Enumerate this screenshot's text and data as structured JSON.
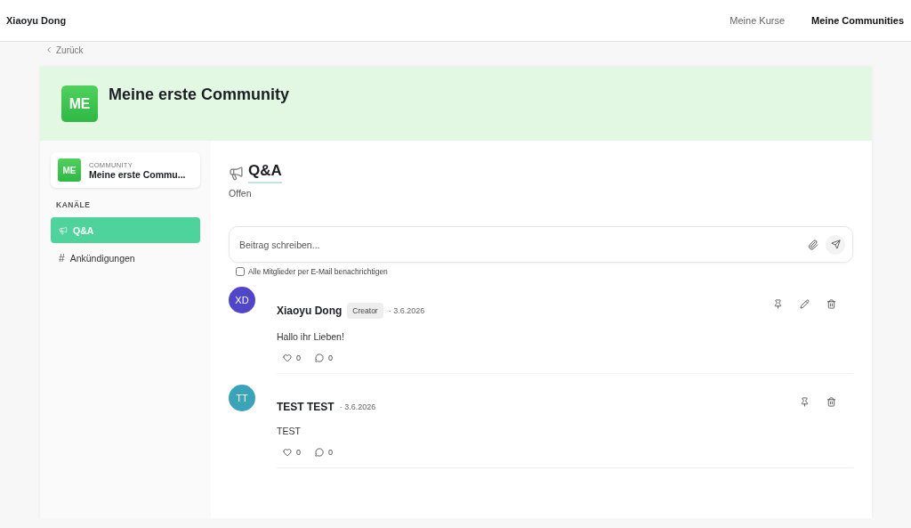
{
  "header": {
    "user": "Xiaoyu Dong",
    "nav": [
      {
        "label": "Meine Kurse",
        "selected": false
      },
      {
        "label": "Meine Communities",
        "selected": true
      }
    ]
  },
  "back": {
    "label": "Zurück"
  },
  "banner": {
    "initials": "ME",
    "title": "Meine erste Community"
  },
  "sidebar": {
    "community": {
      "initials": "ME",
      "label": "COMMUNITY",
      "name": "Meine erste Commu..."
    },
    "section": "KANÄLE",
    "channels": [
      {
        "kind": "megaphone",
        "label": "Q&A",
        "selected": true
      },
      {
        "kind": "hash",
        "icon": "#",
        "label": "Ankündigungen",
        "selected": false
      }
    ]
  },
  "channel": {
    "title": "Q&A",
    "status": "Offen"
  },
  "composer": {
    "placeholder": "Beitrag schreiben...",
    "notify": {
      "label": "Alle Mitglieder per E-Mail benachrichtigen",
      "checked": false
    }
  },
  "posts": [
    {
      "initials": "XD",
      "color": "#5145c9",
      "author": "Xiaoyu Dong",
      "badge": "Creator",
      "date": "· 3.6.2026",
      "text": "Hallo ihr Lieben!",
      "likes": "0",
      "comments": "0",
      "actions": [
        {
          "kind": "pin"
        },
        {
          "kind": "edit"
        },
        {
          "kind": "delete"
        }
      ]
    },
    {
      "initials": "TT",
      "color": "#3aa3b8",
      "author": "TEST TEST",
      "date": "· 3.6.2026",
      "text": "TEST",
      "likes": "0",
      "comments": "0",
      "actions": [
        {
          "kind": "pin"
        },
        {
          "kind": "delete"
        }
      ]
    }
  ]
}
